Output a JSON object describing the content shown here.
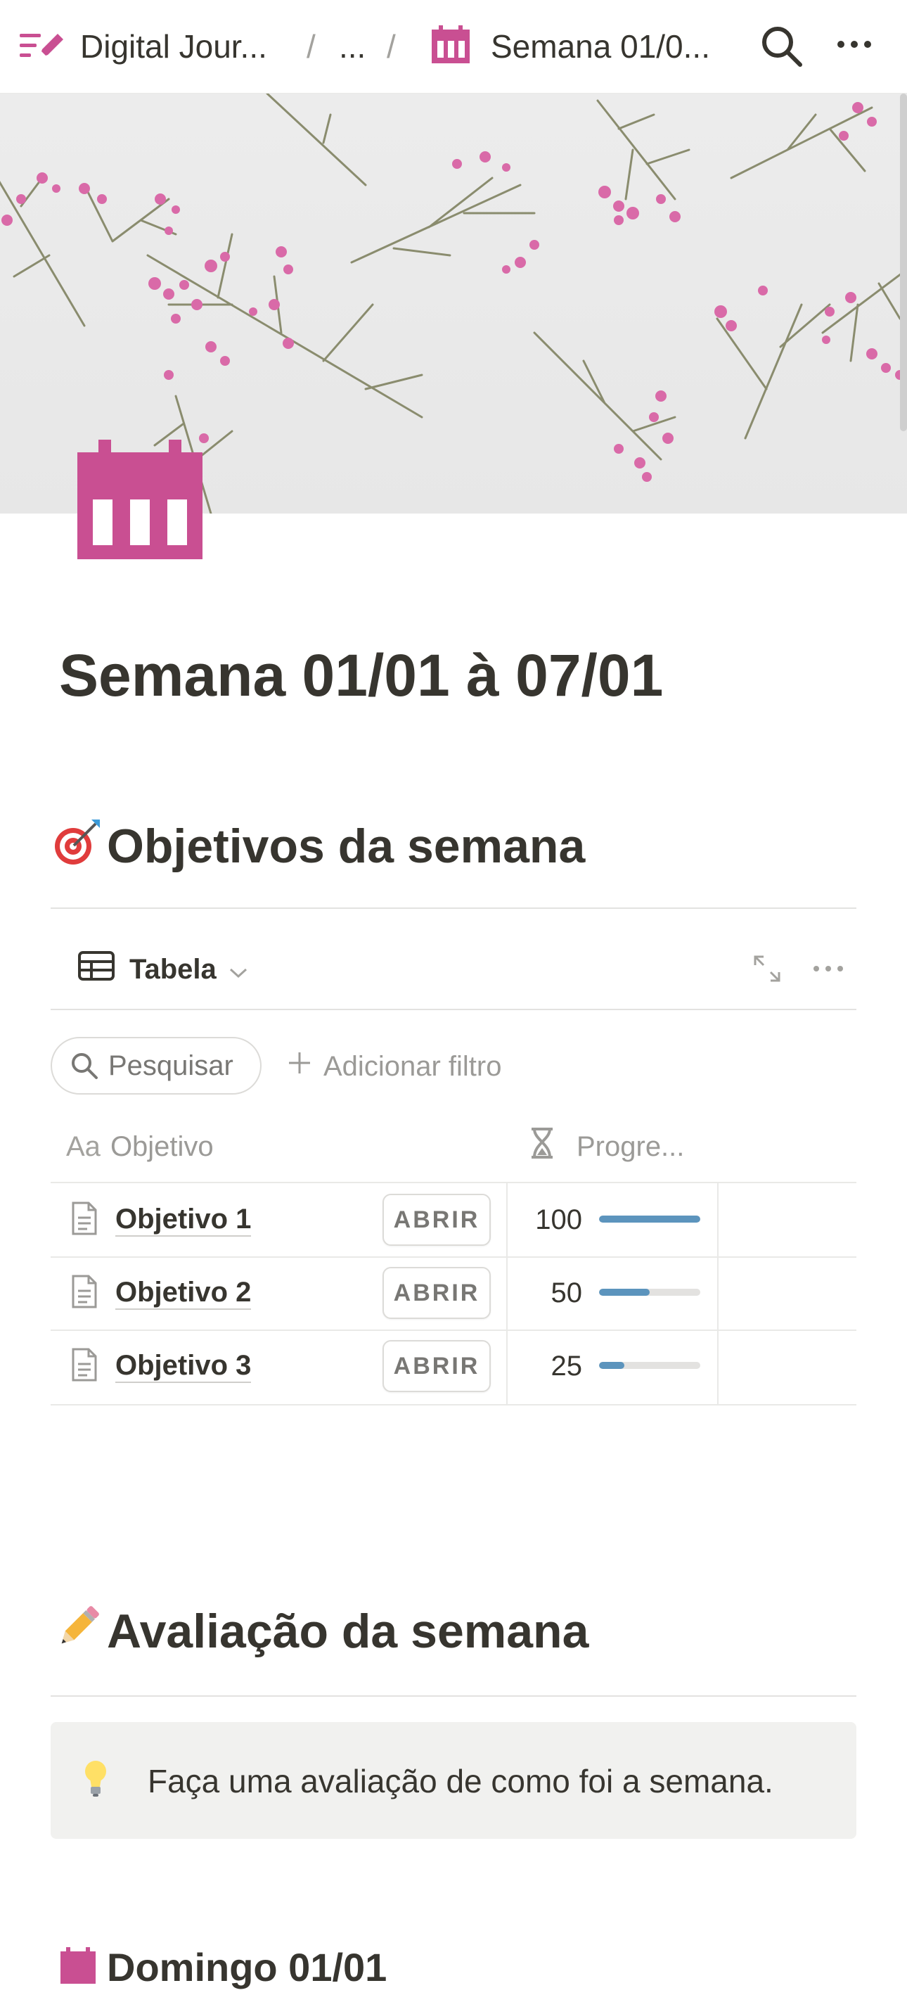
{
  "topbar": {
    "workspace_label": "Digital Jour...",
    "ellipsis_label": "...",
    "separator": "/",
    "page_label": "Semana 01/0..."
  },
  "page": {
    "title": "Semana 01/01 à 07/01",
    "icon": "calendar-icon",
    "accent_color": "#c94f92"
  },
  "objectives": {
    "heading": "Objetivos da semana",
    "heading_icon": "dart-target-icon",
    "view_label": "Tabela",
    "search_placeholder": "Pesquisar",
    "add_filter_label": "Adicionar filtro",
    "col_title_prefix": "Aa",
    "col_title": "Objetivo",
    "col_progress": "Progre...",
    "open_label": "ABRIR",
    "progress_color": "#5c94bd",
    "rows": [
      {
        "name": "Objetivo 1",
        "progress": 100
      },
      {
        "name": "Objetivo 2",
        "progress": 50
      },
      {
        "name": "Objetivo 3",
        "progress": 25
      }
    ]
  },
  "evaluation": {
    "heading": "Avaliação da semana",
    "heading_icon": "pencil-icon",
    "callout_icon": "lightbulb-icon",
    "callout_text": "Faça uma avaliação de como foi a semana."
  },
  "next_section": {
    "heading": "Domingo 01/01",
    "icon": "calendar-icon"
  }
}
